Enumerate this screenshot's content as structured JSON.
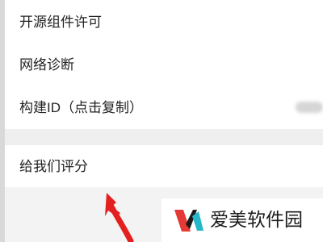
{
  "settings": {
    "items": [
      {
        "label": "开源组件许可"
      },
      {
        "label": "网络诊断"
      },
      {
        "label": "构建ID（点击复制）"
      },
      {
        "label": "给我们评分"
      }
    ]
  },
  "watermark": {
    "text": "爱美软件园",
    "logo_icon": "aimei-logo-icon"
  },
  "annotation": {
    "icon": "red-arrow-icon",
    "color": "#e31f1f"
  },
  "colors": {
    "background": "#f1f1f1",
    "row_background": "#ffffff",
    "text": "#222222",
    "divider": "#e5e5e5"
  }
}
